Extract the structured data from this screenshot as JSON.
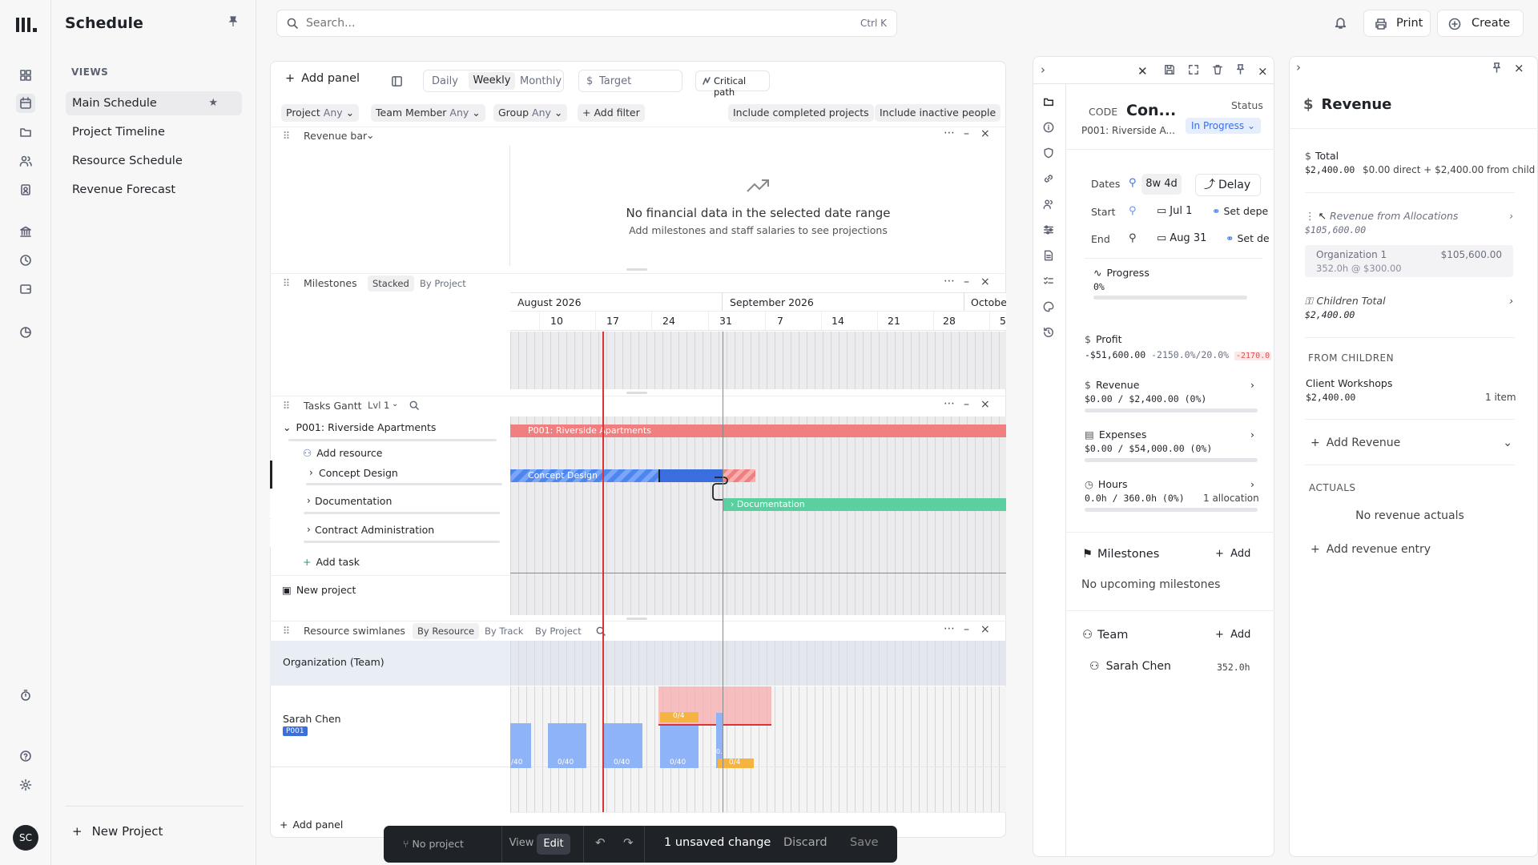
{
  "app": {
    "title": "Schedule",
    "avatar": "SC"
  },
  "sidebar": {
    "views_header": "VIEWS",
    "items": [
      {
        "label": "Main Schedule"
      },
      {
        "label": "Project Timeline"
      },
      {
        "label": "Resource Schedule"
      },
      {
        "label": "Revenue Forecast"
      }
    ],
    "new_project": "New Project"
  },
  "search": {
    "placeholder": "Search...",
    "shortcut": "Ctrl K"
  },
  "top": {
    "print": "Print",
    "create": "Create"
  },
  "toolbar": {
    "add_panel": "Add panel",
    "views": [
      "Daily",
      "Weekly",
      "Monthly"
    ],
    "active_view": "Weekly",
    "target": "Target",
    "critical_path": "Critical path"
  },
  "filters": {
    "project": "Project",
    "project_val": "Any",
    "team": "Team Member",
    "team_val": "Any",
    "group": "Group",
    "group_val": "Any",
    "add_filter": "Add filter",
    "inc_completed": "Include completed projects",
    "inc_inactive": "Include inactive people"
  },
  "revenue_panel": {
    "title": "Revenue bar",
    "empty_title": "No financial data in the selected date range",
    "empty_sub": "Add milestones and staff salaries to see projections"
  },
  "milestones_panel": {
    "title": "Milestones",
    "modes": [
      "Stacked",
      "By Project"
    ],
    "months": [
      "August 2026",
      "September 2026",
      "Octobe"
    ],
    "days": [
      "10",
      "17",
      "24",
      "31",
      "7",
      "14",
      "21",
      "28",
      "5"
    ]
  },
  "gantt_panel": {
    "title": "Tasks Gantt",
    "lvl": "Lvl",
    "lvl_val": "1",
    "project": "P001: Riverside Apartments",
    "add_resource": "Add resource",
    "tasks": [
      "Concept Design",
      "Documentation",
      "Contract Administration"
    ],
    "add_task": "Add task",
    "new_project": "New project",
    "bar_project": "P001: Riverside Apartments",
    "bar_concept": "Concept Design",
    "bar_doc": "Documentation"
  },
  "swim_panel": {
    "title": "Resource swimlanes",
    "modes": [
      "By Resource",
      "By Track",
      "By Project"
    ],
    "org": "Organization (Team)",
    "person": "Sarah Chen",
    "tag": "P001",
    "caps": [
      "/40",
      "0/40",
      "0/40",
      "0/40",
      "0.",
      "0/4",
      "0/4"
    ]
  },
  "add_panel_bottom": "Add panel",
  "bottombar": {
    "no_project": "No project",
    "view": "View",
    "edit": "Edit",
    "changes": "1 unsaved change",
    "discard": "Discard",
    "save": "Save"
  },
  "detail": {
    "code_label": "CODE",
    "code_val": "Con...",
    "status_label": "Status",
    "status_val": "In Progress",
    "project": "P001: Riverside A...",
    "dates_label": "Dates",
    "duration": "8w 4d",
    "delay": "Delay",
    "start_label": "Start",
    "start_val": "Jul 1",
    "set_dep1": "Set depe",
    "end_label": "End",
    "end_val": "Aug 31",
    "set_dep2": "Set de",
    "progress_label": "Progress",
    "progress_val": "0%",
    "progress": 0,
    "profit_label": "Profit",
    "profit_val": "-$51,600.00",
    "profit_pct": "-2150.0%/20.0%",
    "profit_delta": "-2170.0",
    "revenue_label": "Revenue",
    "revenue_val": "$0.00 / $2,400.00 (0%)",
    "expenses_label": "Expenses",
    "expenses_val": "$0.00 / $54,000.00 (0%)",
    "hours_label": "Hours",
    "hours_val": "0.0h / 360.0h (0%)",
    "allocations": "1 allocation",
    "milestones_label": "Milestones",
    "add": "Add",
    "no_milestones": "No upcoming milestones",
    "team_label": "Team",
    "member": "Sarah Chen",
    "member_hours": "352.0h"
  },
  "revpanel": {
    "title": "Revenue",
    "total_label": "Total",
    "total_val": "$2,400.00",
    "total_detail": "$0.00 direct + $2,400.00 from child",
    "alloc_label": "Revenue from Allocations",
    "alloc_val": "$105,600.00",
    "org": "Organization 1",
    "org_val": "$105,600.00",
    "org_detail": "352.0h @ $300.00",
    "children_label": "Children Total",
    "children_val": "$2,400.00",
    "from_children": "FROM CHILDREN",
    "child_name": "Client Workshops",
    "child_val": "$2,400.00",
    "child_count": "1 item",
    "add_revenue": "Add Revenue",
    "actuals": "ACTUALS",
    "no_actuals": "No revenue actuals",
    "add_entry": "Add revenue entry"
  },
  "colors": {
    "accent": "#3b6fe0",
    "red": "#f08080",
    "green": "#5ccfa0",
    "orange": "#f5b342",
    "blue": "#4d86f0"
  }
}
